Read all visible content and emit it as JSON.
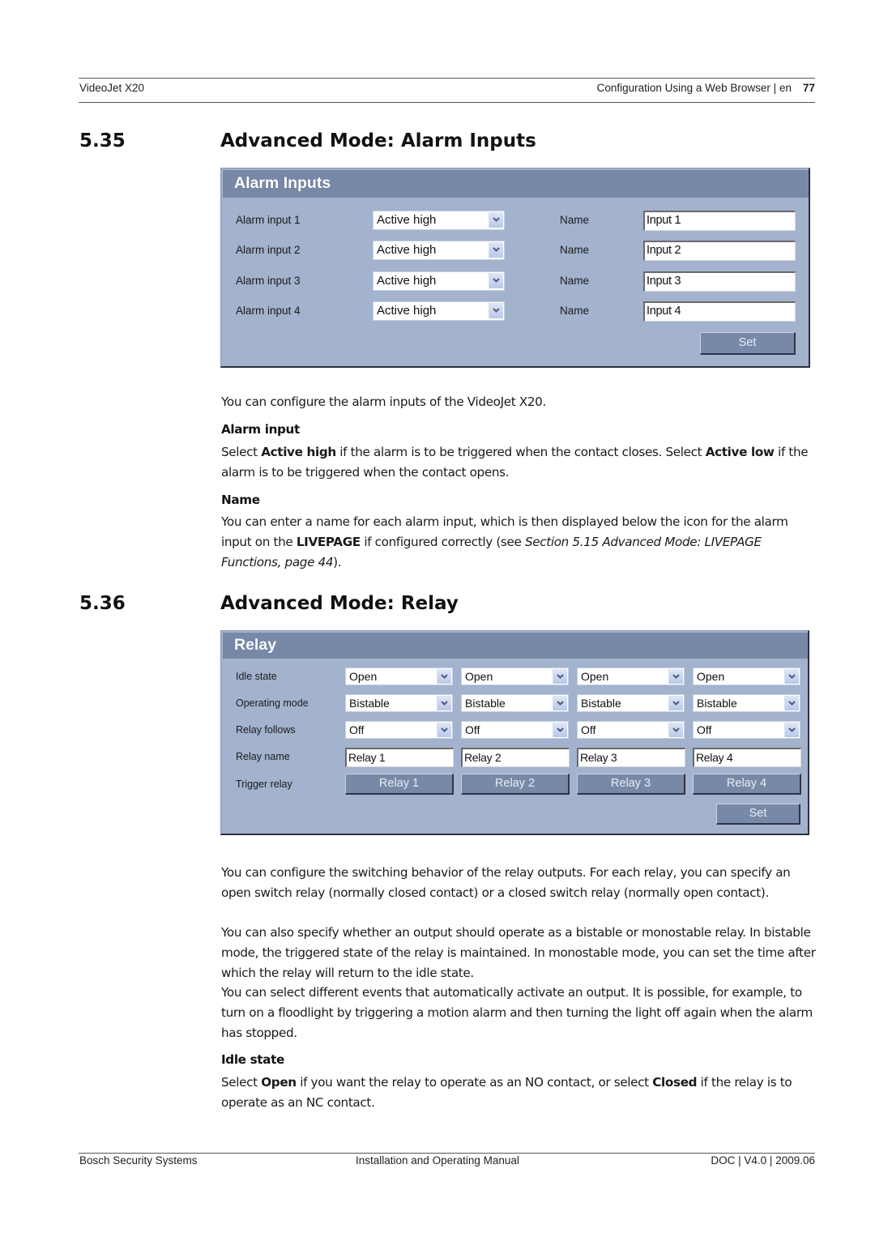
{
  "header": {
    "product": "VideoJet X20",
    "chapter": "Configuration Using a Web Browser | en",
    "page_number": "77"
  },
  "section_alarm": {
    "number": "5.35",
    "title": "Advanced Mode: Alarm Inputs",
    "panel": {
      "title": "Alarm Inputs",
      "rows": [
        {
          "label": "Alarm input 1",
          "mode": "Active high",
          "name_label": "Name",
          "name_value": "Input 1"
        },
        {
          "label": "Alarm input 2",
          "mode": "Active high",
          "name_label": "Name",
          "name_value": "Input 2"
        },
        {
          "label": "Alarm input 3",
          "mode": "Active high",
          "name_label": "Name",
          "name_value": "Input 3"
        },
        {
          "label": "Alarm input 4",
          "mode": "Active high",
          "name_label": "Name",
          "name_value": "Input 4"
        }
      ],
      "set_button": "Set"
    },
    "intro": "You can configure the alarm inputs of the VideoJet X20.",
    "alarm_input": {
      "heading": "Alarm input",
      "t1": "Select ",
      "b1": "Active high",
      "t2": " if the alarm is to be triggered when the contact closes. Select ",
      "b2": "Active low",
      "t3": " if the alarm is to be triggered when the contact opens."
    },
    "name": {
      "heading": "Name",
      "t1": "You can enter a name for each alarm input, which is then displayed below the icon for the alarm input on the ",
      "b1": "LIVEPAGE",
      "t2": " if configured correctly (see ",
      "i1": "Section 5.15 Advanced Mode: LIVEPAGE Functions, page 44",
      "t3": ")."
    }
  },
  "section_relay": {
    "number": "5.36",
    "title": "Advanced Mode: Relay",
    "panel": {
      "title": "Relay",
      "row_labels": {
        "idle_state": "Idle state",
        "operating_mode": "Operating mode",
        "relay_follows": "Relay follows",
        "relay_name": "Relay name",
        "trigger_relay": "Trigger relay"
      },
      "relays": [
        {
          "idle_state": "Open",
          "operating_mode": "Bistable",
          "relay_follows": "Off",
          "name": "Relay 1",
          "trigger": "Relay 1"
        },
        {
          "idle_state": "Open",
          "operating_mode": "Bistable",
          "relay_follows": "Off",
          "name": "Relay 2",
          "trigger": "Relay 2"
        },
        {
          "idle_state": "Open",
          "operating_mode": "Bistable",
          "relay_follows": "Off",
          "name": "Relay 3",
          "trigger": "Relay 3"
        },
        {
          "idle_state": "Open",
          "operating_mode": "Bistable",
          "relay_follows": "Off",
          "name": "Relay 4",
          "trigger": "Relay 4"
        }
      ],
      "set_button": "Set"
    },
    "p1": "You can configure the switching behavior of the relay outputs. For each relay, you can specify an open switch relay (normally closed contact) or a closed switch relay (normally open contact).",
    "p2": "You can also specify whether an output should operate as a bistable or monostable relay. In bistable mode, the triggered state of the relay is maintained. In monostable mode, you can set the time after which the relay will return to the idle state.",
    "p3": "You can select different events that automatically activate an output. It is possible, for example, to turn on a floodlight by triggering a motion alarm and then turning the light off again when the alarm has stopped.",
    "idle_state": {
      "heading": "Idle state",
      "t1": "Select ",
      "b1": "Open",
      "t2": " if you want the relay to operate as an NO contact, or select ",
      "b2": "Closed",
      "t3": " if the relay is to operate as an NC contact."
    }
  },
  "footer": {
    "company": "Bosch Security Systems",
    "manual": "Installation and Operating Manual",
    "doc": "DOC | V4.0 | 2009.06"
  }
}
